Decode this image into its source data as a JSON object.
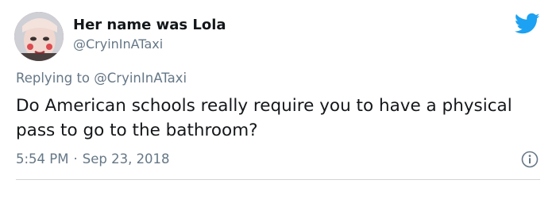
{
  "tweet": {
    "author": {
      "display_name": "Her name was Lola",
      "handle": "@CryinInATaxi"
    },
    "reply": {
      "prefix": "Replying to",
      "mention": "@CryinInATaxi"
    },
    "text": "Do American schools really require you to have a physical pass to go to the bathroom?",
    "time": "5:54 PM",
    "separator": "·",
    "date": "Sep 23, 2018"
  },
  "icons": {
    "brand": "twitter-bird-icon",
    "info": "info-icon"
  },
  "colors": {
    "brand": "#1da1f2",
    "secondary_text": "#657786",
    "primary_text": "#14171a"
  }
}
